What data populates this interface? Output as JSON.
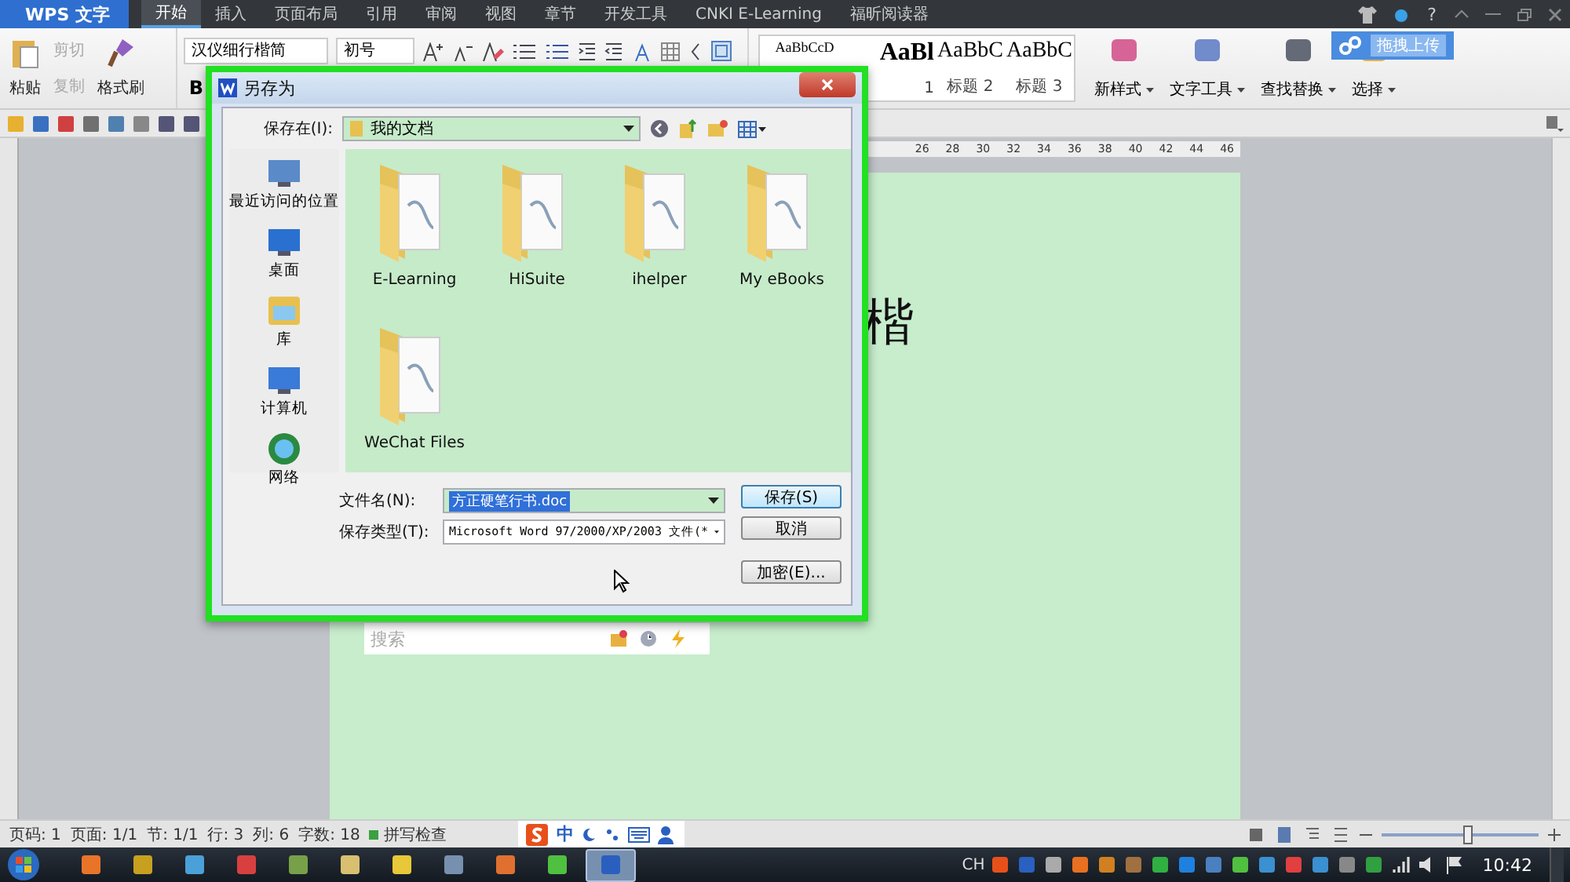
{
  "app_menu": {
    "label": "WPS 文字"
  },
  "tabs": [
    {
      "label": "开始",
      "selected": true
    },
    {
      "label": "插入",
      "selected": false
    },
    {
      "label": "页面布局",
      "selected": false
    },
    {
      "label": "引用",
      "selected": false
    },
    {
      "label": "审阅",
      "selected": false
    },
    {
      "label": "视图",
      "selected": false
    },
    {
      "label": "章节",
      "selected": false
    },
    {
      "label": "开发工具",
      "selected": false
    },
    {
      "label": "CNKI E-Learning",
      "selected": false
    },
    {
      "label": "福昕阅读器",
      "selected": false
    }
  ],
  "help": "?",
  "ribbon": {
    "paste": "粘贴",
    "cut": "剪切",
    "copy": "复制",
    "format_painter": "格式刷",
    "font_name": "汉仪细行楷简",
    "font_size": "初号",
    "bold": "B",
    "styles": [
      {
        "preview": "AaBbCcD"
      },
      {
        "preview": "AaBl",
        "label": "1"
      },
      {
        "preview": "AaBbC",
        "label": "标题 2"
      },
      {
        "preview": "AaBbC",
        "label": "标题 3"
      }
    ],
    "tools": [
      {
        "label": "新样式",
        "kind": "style"
      },
      {
        "label": "文字工具",
        "kind": "text"
      },
      {
        "label": "查找替换",
        "kind": "find"
      },
      {
        "label": "选择",
        "kind": "select"
      }
    ]
  },
  "upload_tip": "拖拽上传",
  "ruler_numbers": [
    "26",
    "28",
    "30",
    "32",
    "34",
    "36",
    "38",
    "40",
    "42",
    "44",
    "46"
  ],
  "document": {
    "text": "楷"
  },
  "search_popup": {
    "placeholder": "搜索"
  },
  "dialog": {
    "title": "另存为",
    "save_in_label": "保存在(I):",
    "save_in_value": "我的文档",
    "places": [
      {
        "label": "最近访问的位置",
        "kind": "recent"
      },
      {
        "label": "桌面",
        "kind": "desktop"
      },
      {
        "label": "库",
        "kind": "library"
      },
      {
        "label": "计算机",
        "kind": "computer"
      },
      {
        "label": "网络",
        "kind": "network"
      }
    ],
    "folders": [
      {
        "name": "E-Learning"
      },
      {
        "name": "HiSuite"
      },
      {
        "name": "ihelper"
      },
      {
        "name": "My eBooks"
      },
      {
        "name": "WeChat Files"
      }
    ],
    "filename_label": "文件名(N):",
    "filename": {
      "value": "方正硬笔行书.doc",
      "selected": true
    },
    "filetype_label": "保存类型(T):",
    "filetype": "Microsoft Word 97/2000/XP/2003 文件(*",
    "buttons": [
      {
        "label": "保存(S)",
        "kind": "default"
      },
      {
        "label": "取消",
        "kind": "normal"
      },
      {
        "label": "加密(E)...",
        "kind": "normal"
      }
    ]
  },
  "status_bar": {
    "items": [
      "页码: 1",
      "页面: 1/1",
      "节: 1/1",
      "行: 3",
      "列: 6",
      "字数: 18"
    ],
    "spell_check": "拼写检查",
    "ime": "中",
    "zoom": {
      "level": 0.55
    }
  },
  "taskbar": {
    "apps": [
      {
        "color": "#e8742a",
        "selected": false
      },
      {
        "color": "#c8a020",
        "selected": false
      },
      {
        "color": "#4aa0d8",
        "selected": false
      },
      {
        "color": "#d84040",
        "selected": false
      },
      {
        "color": "#78a048",
        "selected": false
      },
      {
        "color": "#d8c070",
        "selected": false
      },
      {
        "color": "#e8c838",
        "selected": false
      },
      {
        "color": "#7890b0",
        "selected": false
      },
      {
        "color": "#e07030",
        "selected": false
      },
      {
        "color": "#50c040",
        "selected": false
      },
      {
        "color": "#2a5fc0",
        "selected": true
      }
    ],
    "language": "CH",
    "clock": "10:42"
  }
}
